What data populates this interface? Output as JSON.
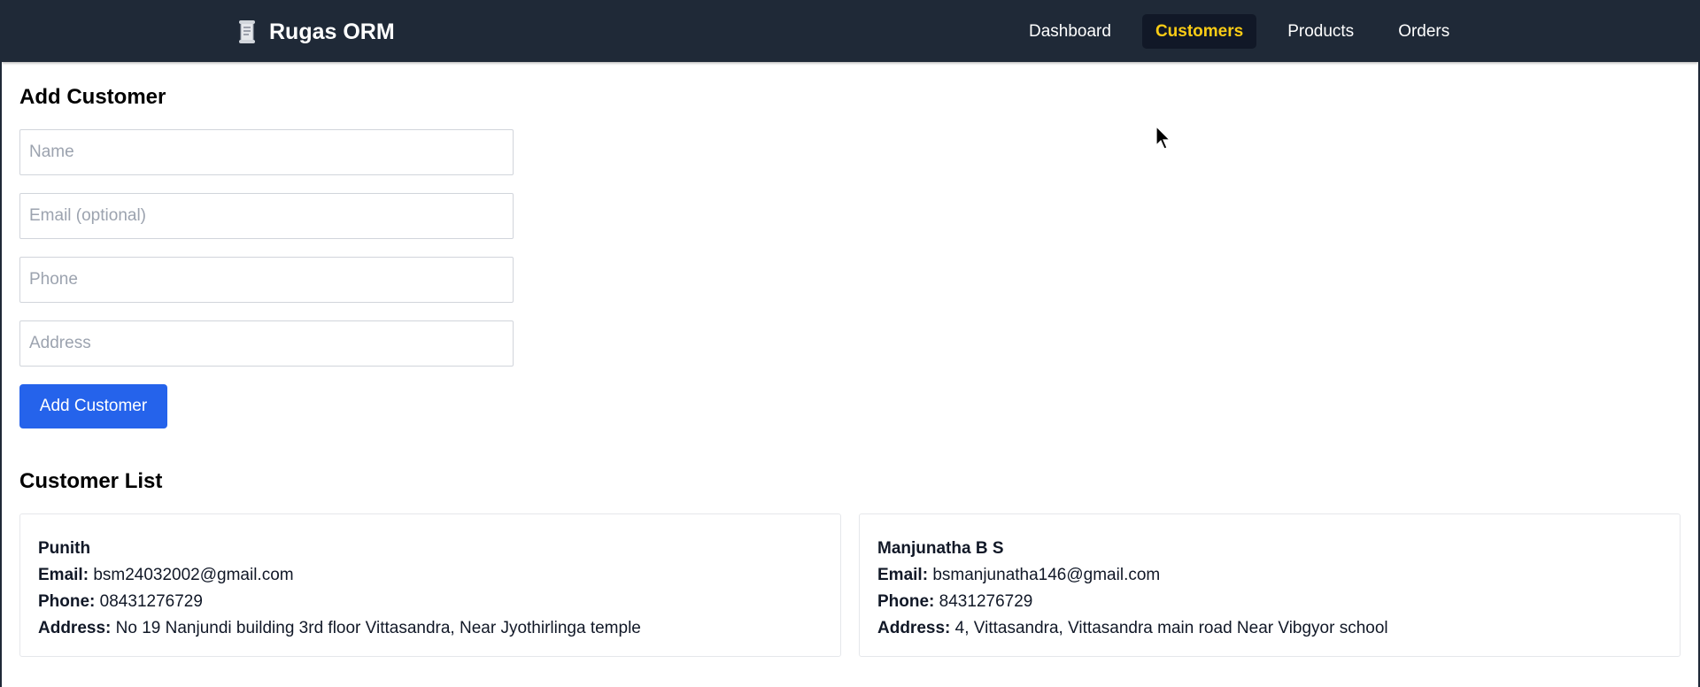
{
  "navbar": {
    "brand": "Rugas ORM",
    "brand_icon": "receipt-icon",
    "links": [
      {
        "label": "Dashboard",
        "active": false
      },
      {
        "label": "Customers",
        "active": true
      },
      {
        "label": "Products",
        "active": false
      },
      {
        "label": "Orders",
        "active": false
      }
    ],
    "active_color": "#facc15",
    "background": "#1f2937"
  },
  "form": {
    "title": "Add Customer",
    "name_placeholder": "Name",
    "email_placeholder": "Email (optional)",
    "phone_placeholder": "Phone",
    "address_placeholder": "Address",
    "submit_label": "Add Customer",
    "button_color": "#2563eb"
  },
  "list": {
    "title": "Customer List",
    "email_label": "Email:",
    "phone_label": "Phone:",
    "address_label": "Address:",
    "customers": [
      {
        "name": "Punith",
        "email": "bsm24032002@gmail.com",
        "phone": "08431276729",
        "address": "No 19 Nanjundi building 3rd floor Vittasandra, Near Jyothirlinga temple"
      },
      {
        "name": "Manjunatha B S",
        "email": "bsmanjunatha146@gmail.com",
        "phone": "8431276729",
        "address": "4, Vittasandra, Vittasandra main road Near Vibgyor school"
      }
    ]
  }
}
